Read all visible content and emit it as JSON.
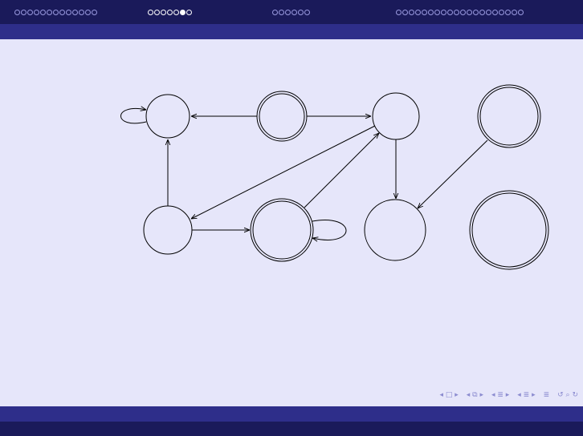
{
  "navigation": {
    "sections": [
      {
        "dots": 13,
        "current": -1
      },
      {
        "dots": 7,
        "current": 5
      },
      {
        "dots": 6,
        "current": -1
      },
      {
        "dots": 20,
        "current": -1
      }
    ]
  },
  "diagram": {
    "states": [
      {
        "id": "s1",
        "accepting": false
      },
      {
        "id": "s2",
        "accepting": true
      },
      {
        "id": "s3",
        "accepting": false
      },
      {
        "id": "s4",
        "accepting": true
      },
      {
        "id": "s5",
        "accepting": false
      },
      {
        "id": "s6",
        "accepting": true
      },
      {
        "id": "s7",
        "accepting": false
      },
      {
        "id": "s8",
        "accepting": true
      }
    ],
    "transitions": [
      {
        "from": "s1",
        "to": "s1",
        "loop": true
      },
      {
        "from": "s2",
        "to": "s1"
      },
      {
        "from": "s2",
        "to": "s3"
      },
      {
        "from": "s3",
        "to": "s5"
      },
      {
        "from": "s3",
        "to": "s7"
      },
      {
        "from": "s5",
        "to": "s1"
      },
      {
        "from": "s5",
        "to": "s6"
      },
      {
        "from": "s6",
        "to": "s6",
        "loop": true
      },
      {
        "from": "s6",
        "to": "s3"
      },
      {
        "from": "s4",
        "to": "s7"
      }
    ]
  },
  "footer": {
    "nav_icons": [
      "frame-prev-icon",
      "frame-icon",
      "frame-next-icon",
      "subsection-prev-icon",
      "subsection-icon",
      "subsection-next-icon",
      "section-prev-icon",
      "section-icon",
      "section-next-icon",
      "doc-icon",
      "search-icon"
    ]
  },
  "colors": {
    "background": "#e6e6fa",
    "header_dark": "#1a1a5a",
    "header_light": "#2e2e8a"
  }
}
